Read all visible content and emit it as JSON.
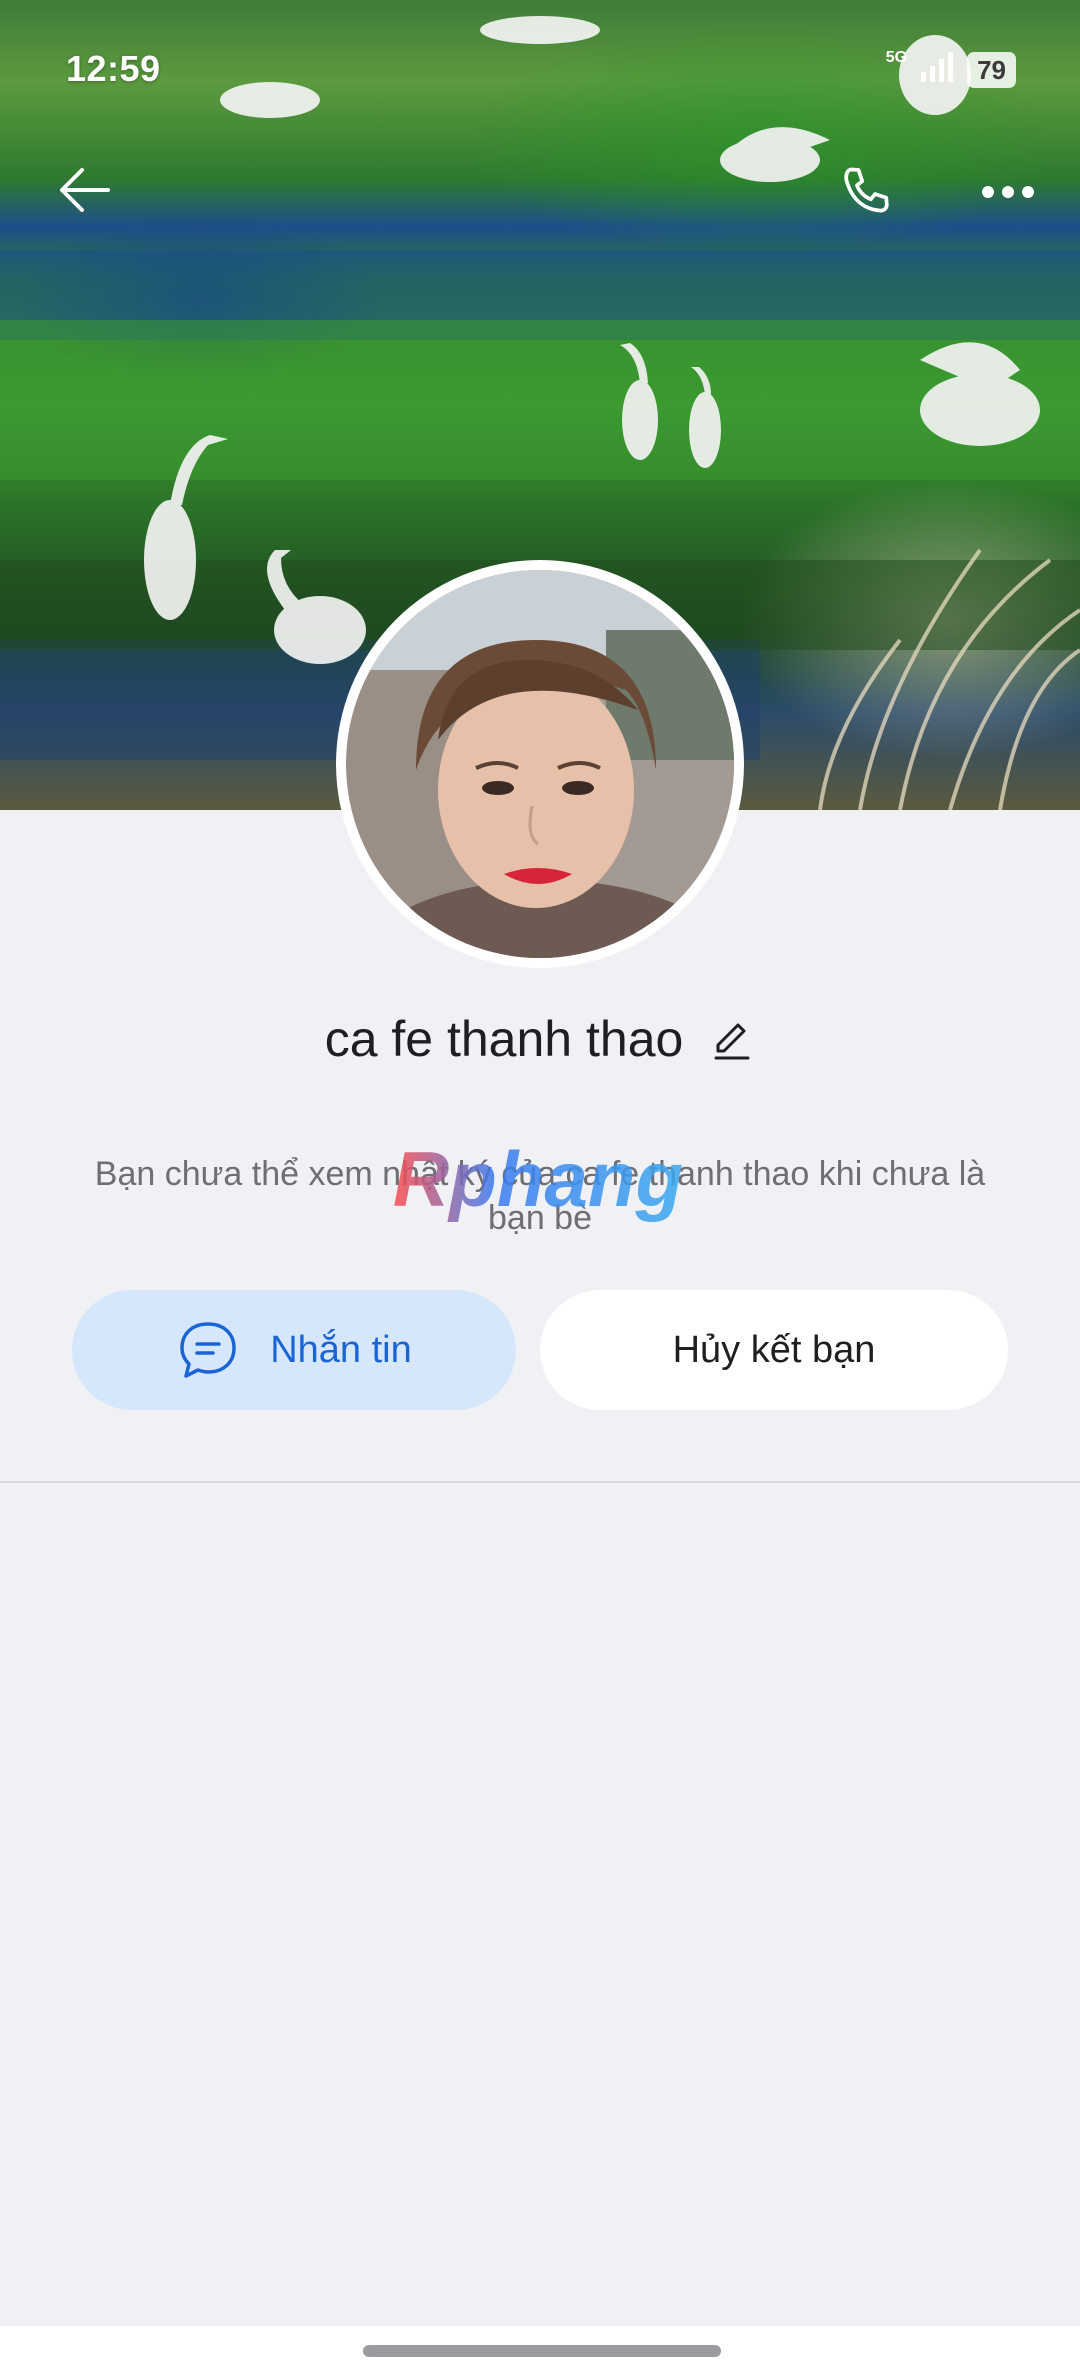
{
  "status_bar": {
    "time": "12:59",
    "network": "5G",
    "battery": "79"
  },
  "nav": {
    "back_icon": "arrow-left-icon",
    "call_icon": "phone-icon",
    "more_icon": "more-dots-icon"
  },
  "profile": {
    "name": "ca fe thanh thao",
    "edit_icon": "pencil-icon",
    "info_text": "Bạn chưa thể xem nhật ký của ca fe thanh thao khi chưa là bạn bè",
    "watermark": "Rphang"
  },
  "actions": {
    "message_label": "Nhắn tin",
    "message_icon": "chat-bubble-icon",
    "unfriend_label": "Hủy kết bạn"
  },
  "colors": {
    "accent_blue": "#1a65d6",
    "message_button_bg": "#d6e6fb",
    "page_bg": "#f0f1f5"
  }
}
